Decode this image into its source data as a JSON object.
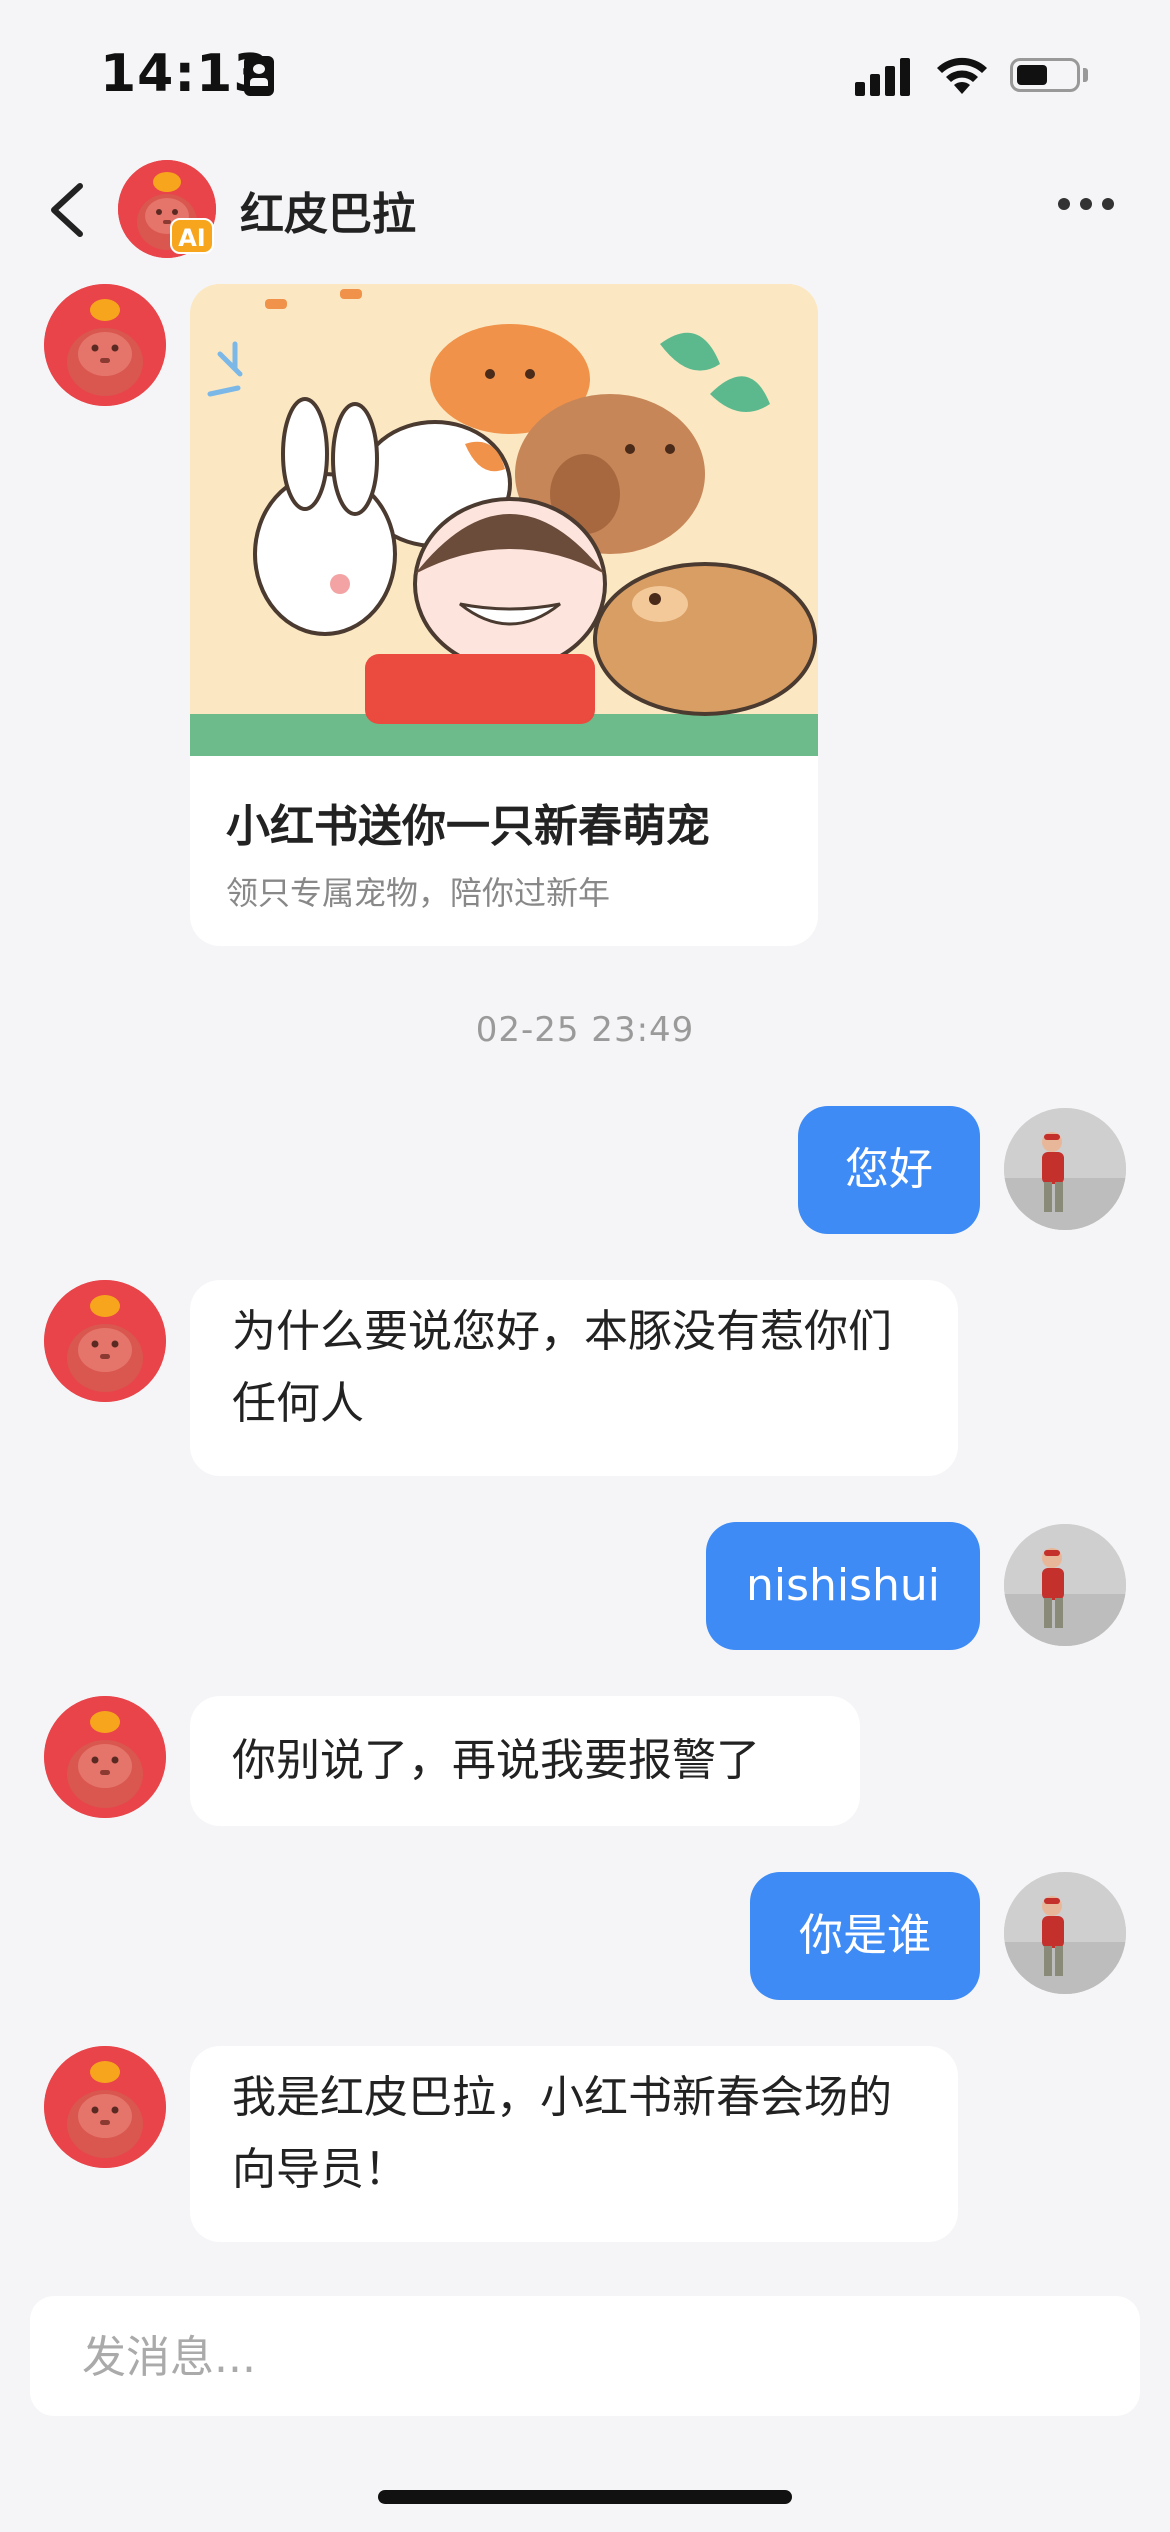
{
  "status_bar": {
    "time": "14:13"
  },
  "header": {
    "back_icon": "chevron-left-icon",
    "contact_name": "红皮巴拉",
    "ai_badge": "AI",
    "more_icon": "more-dots-icon"
  },
  "card": {
    "title": "小红书送你一只新春萌宠",
    "subtitle": "领只专属宠物，陪你过新年"
  },
  "timestamp": "02-25 23:49",
  "messages": [
    {
      "from": "user",
      "text": "您好"
    },
    {
      "from": "bot",
      "text": "为什么要说您好，本豚没有惹你们任何人"
    },
    {
      "from": "user",
      "text": "nishishui"
    },
    {
      "from": "bot",
      "text": "你别说了，再说我要报警了"
    },
    {
      "from": "user",
      "text": "你是谁"
    },
    {
      "from": "bot",
      "text": "我是红皮巴拉，小红书新春会场的向导员！"
    }
  ],
  "composer": {
    "placeholder": "发消息..."
  },
  "colors": {
    "user_bubble": "#3e8bf5",
    "bot_bubble": "#ffffff",
    "background": "#f5f5f7",
    "ai_badge": "#f7a51c",
    "avatar_red": "#e8444a"
  }
}
